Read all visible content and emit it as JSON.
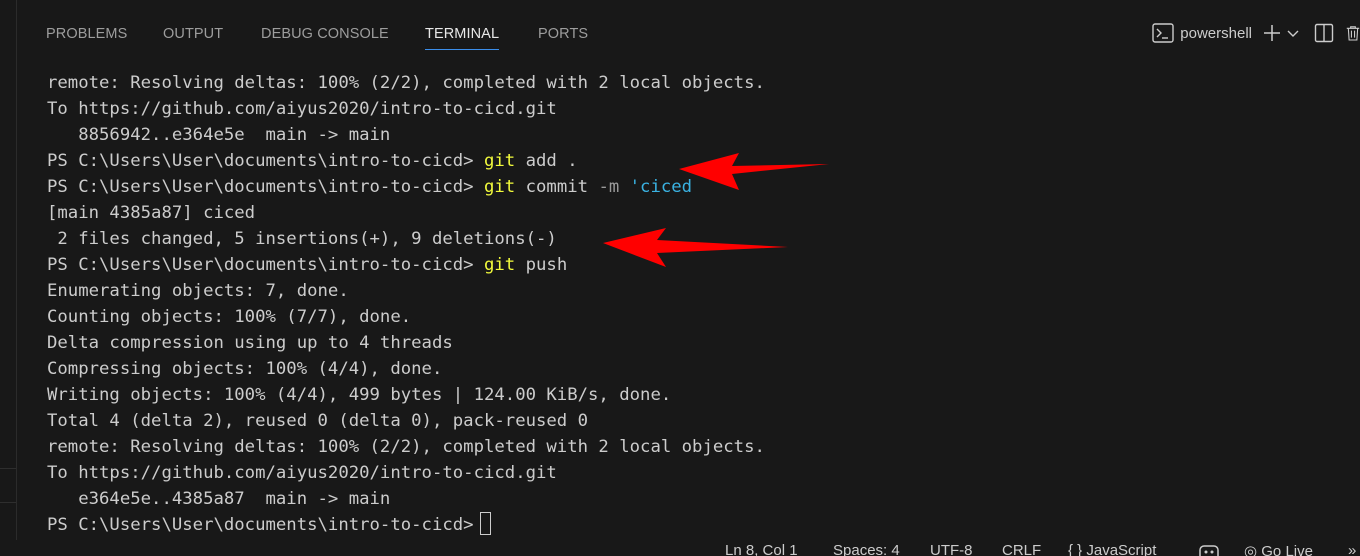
{
  "tabs": [
    {
      "label": "PROBLEMS"
    },
    {
      "label": "OUTPUT"
    },
    {
      "label": "DEBUG CONSOLE"
    },
    {
      "label": "TERMINAL"
    },
    {
      "label": "PORTS"
    }
  ],
  "active_tab": "TERMINAL",
  "toolbar": {
    "shell_label": "powershell",
    "icons": [
      "terminal-icon",
      "plus-icon",
      "chevron-down-icon",
      "split-icon",
      "trash-icon"
    ]
  },
  "terminal": {
    "prompt": "PS C:\\Users\\User\\documents\\intro-to-cicd>",
    "lines": {
      "l1": "remote: Resolving deltas: 100% (2/2), completed with 2 local objects.",
      "l2": "To https://github.com/aiyus2020/intro-to-cicd.git",
      "l3": "   8856942..e364e5e  main -> main",
      "l4_cmd": "git",
      "l4_rest": " add .",
      "l5_cmd": "git",
      "l5_rest": " commit ",
      "l5_flag": "-m",
      "l5_str": " 'ciced",
      "l6": "[main 4385a87] ciced",
      "l7": " 2 files changed, 5 insertions(+), 9 deletions(-)",
      "l8_cmd": "git",
      "l8_rest": " push",
      "l9": "Enumerating objects: 7, done.",
      "l10": "Counting objects: 100% (7/7), done.",
      "l11": "Delta compression using up to 4 threads",
      "l12": "Compressing objects: 100% (4/4), done.",
      "l13": "Writing objects: 100% (4/4), 499 bytes | 124.00 KiB/s, done.",
      "l14": "Total 4 (delta 2), reused 0 (delta 0), pack-reused 0",
      "l15": "remote: Resolving deltas: 100% (2/2), completed with 2 local objects.",
      "l16": "To https://github.com/aiyus2020/intro-to-cicd.git",
      "l17": "   e364e5e..4385a87  main -> main"
    }
  },
  "annotations": {
    "arrow_color": "#ff0000"
  },
  "colors": {
    "cmd": "#f1fa3c",
    "string": "#3ab2e2",
    "flag": "#9a9a9a",
    "text": "#cccccc",
    "background": "#181818"
  },
  "statusbar": {
    "position": "Ln 8, Col 1",
    "spaces": "Spaces: 4",
    "encoding": "UTF-8",
    "eol": "CRLF",
    "language": "JavaScript",
    "go_live": "Go Live"
  }
}
